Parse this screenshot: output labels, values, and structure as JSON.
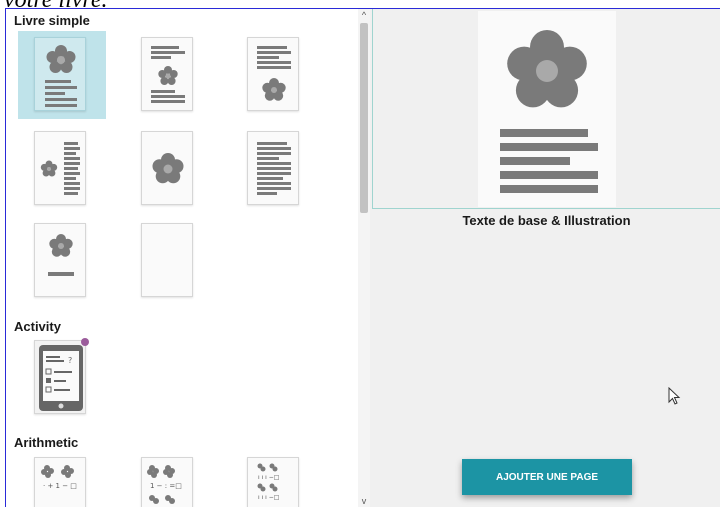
{
  "caption": "votre livre.",
  "sections": {
    "simple": "Livre simple",
    "activity": "Activity",
    "arithmetic": "Arithmetic"
  },
  "preview": {
    "title": "Texte de base & Illustration"
  },
  "add_page_button": "Ajouter une page",
  "colors": {
    "accent": "#1c94a4",
    "selected": "#bfe3ea",
    "graphic": "#7a7a7a"
  }
}
